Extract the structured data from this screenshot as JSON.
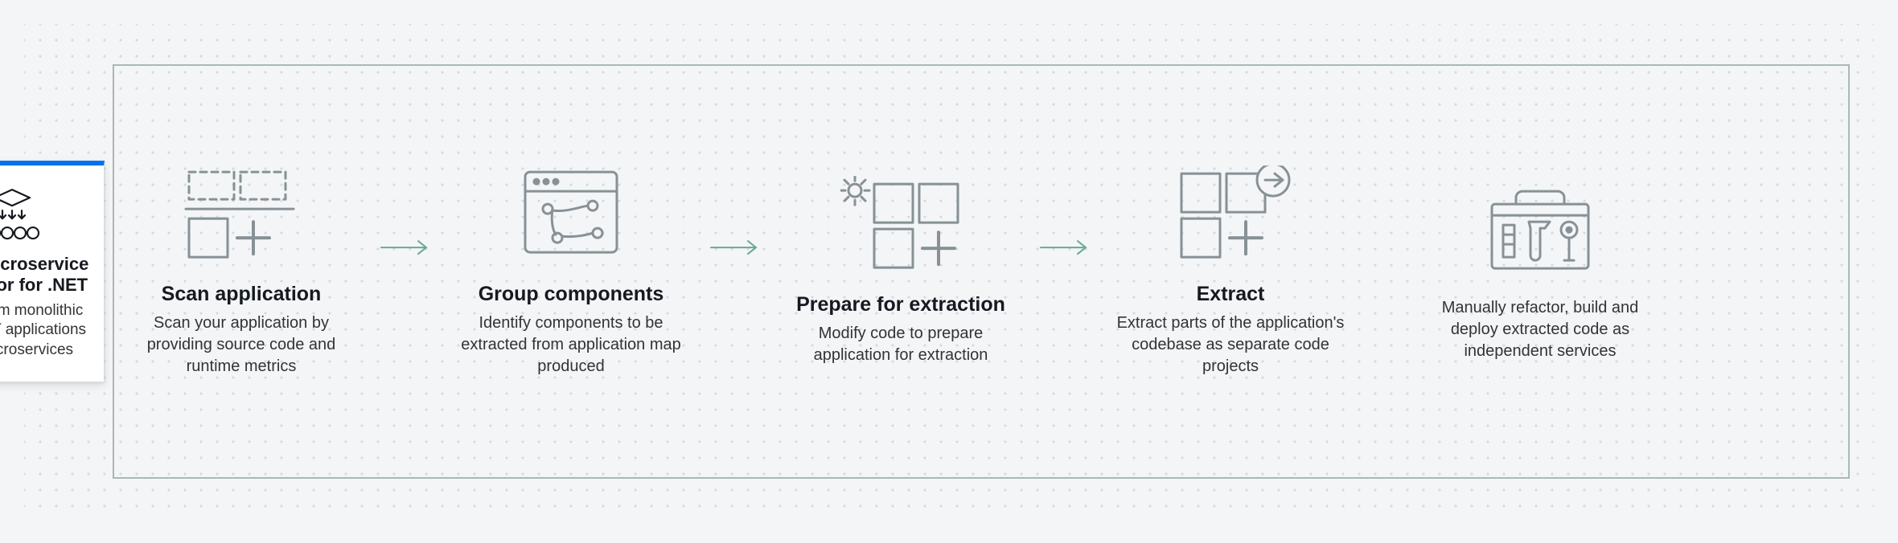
{
  "card": {
    "title": "AWS Microservice Extractor for .NET",
    "subtitle": "Transform monolithic ASP.NET applications into microservices"
  },
  "steps": [
    {
      "title": "Scan application",
      "desc": "Scan your application by providing source code and runtime metrics"
    },
    {
      "title": "Group components",
      "desc": "Identify components to be extracted from application map produced"
    },
    {
      "title": "Prepare for extraction",
      "desc": "Modify code to prepare application for extraction"
    },
    {
      "title": "Extract",
      "desc": "Extract parts of the application's codebase as separate code projects"
    }
  ],
  "end": {
    "desc": "Manually refactor, build and deploy extracted code as independent services"
  }
}
